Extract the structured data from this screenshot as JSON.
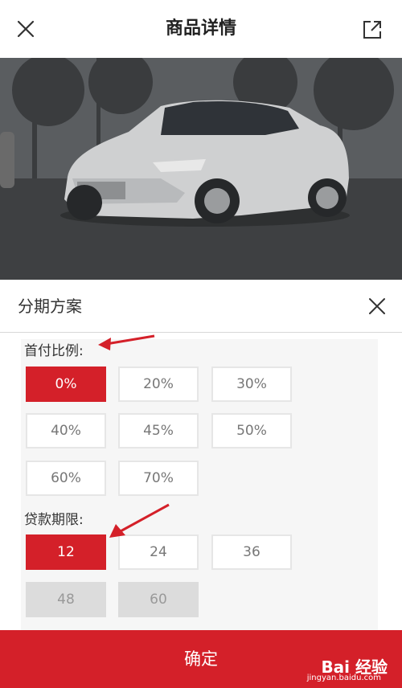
{
  "nav": {
    "title": "商品详情",
    "close_icon": "close-icon",
    "share_icon": "share-icon"
  },
  "sheet": {
    "title": "分期方案",
    "close_icon": "close-icon"
  },
  "down_payment": {
    "label": "首付比例:",
    "options": [
      "0%",
      "20%",
      "30%",
      "40%",
      "45%",
      "50%",
      "60%",
      "70%"
    ],
    "selected": "0%"
  },
  "loan_term": {
    "label": "贷款期限:",
    "options": [
      "12",
      "24",
      "36",
      "48",
      "60"
    ],
    "selected": "12",
    "disabled": [
      "48",
      "60"
    ]
  },
  "confirm_label": "确定",
  "watermark": {
    "brand": "Bai 经验",
    "url": "jingyan.baidu.com"
  },
  "colors": {
    "accent": "#d42029",
    "annotation_arrow": "#d42029"
  }
}
